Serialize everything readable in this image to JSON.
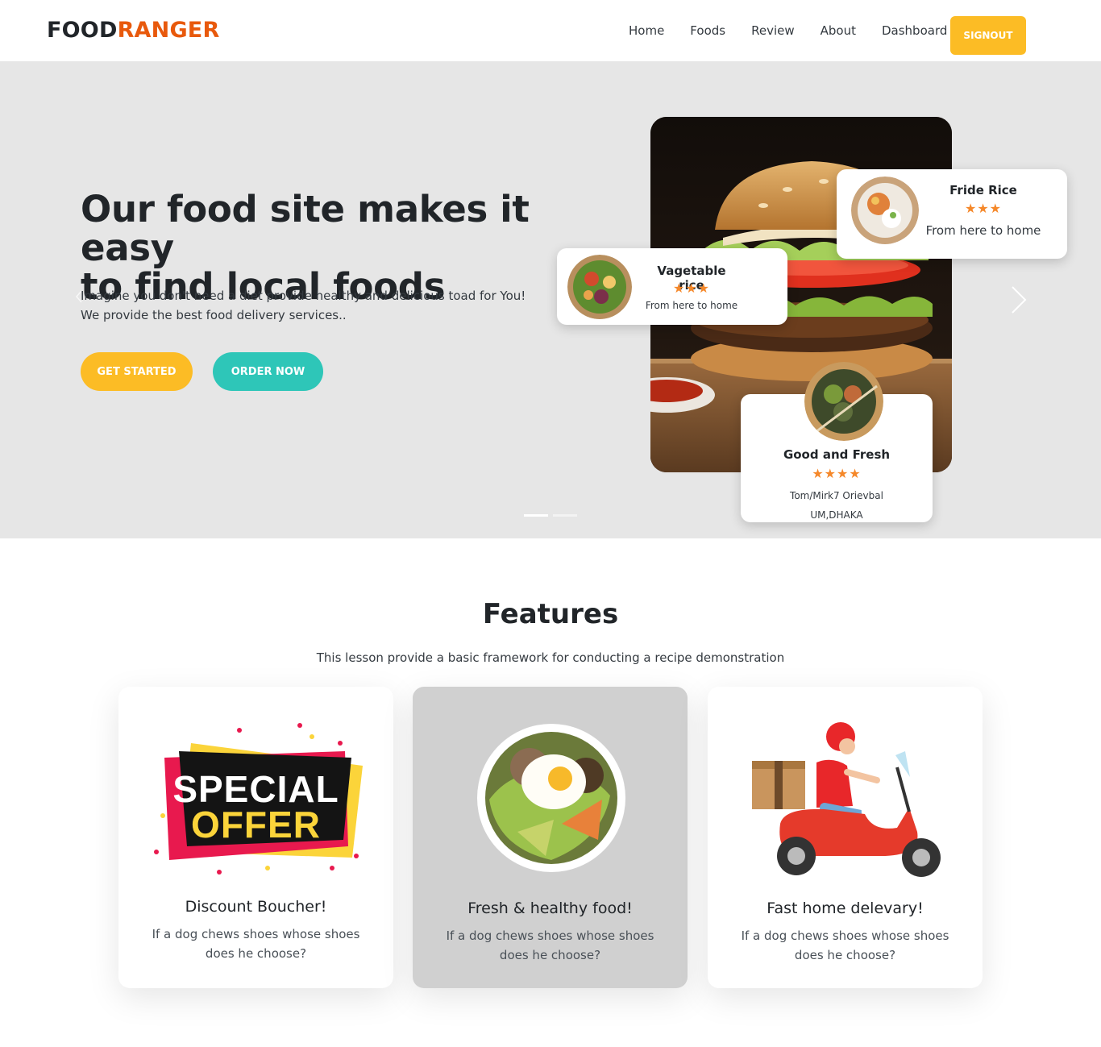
{
  "navbar": {
    "brand_part1": "FOOD",
    "brand_part2": "RANGER",
    "links": [
      "Home",
      "Foods",
      "Review",
      "About",
      "Dashboard"
    ],
    "signout_label": "SIGNOUT"
  },
  "hero": {
    "title_line1": "Our food site makes it easy",
    "title_line2": "to find local foods",
    "desc_line1": "Imagine you don't need a diet provide healthy and delicious toad for You!",
    "desc_line2": "We provide the best food delivery services..",
    "get_started_label": "GET STARTED",
    "order_now_label": "ORDER NOW",
    "prev_icon": "chevron-left-icon",
    "next_icon": "chevron-right-icon",
    "slides_count": 2,
    "active_slide": 1
  },
  "float_cards": {
    "fride": {
      "title": "Fride Rice",
      "stars": "★★★",
      "rating": 3,
      "subtitle": "From here to home"
    },
    "veg": {
      "title": "Vagetable rice",
      "stars": "★★★",
      "rating": 3,
      "subtitle": "From here to home"
    },
    "good": {
      "title": "Good and Fresh",
      "stars": "★★★★",
      "rating": 4,
      "line1": "Tom/Mirk7 Orievbal",
      "line2": "UM,DHAKA"
    }
  },
  "features": {
    "title": "Features",
    "subtitle": "This lesson provide a basic framework for conducting a recipe demonstration",
    "cards": [
      {
        "title": "Discount Boucher!",
        "text_line1": "If a dog chews shoes whose shoes",
        "text_line2": "does he choose?",
        "badge_line1": "SPECIAL",
        "badge_line2": "OFFER"
      },
      {
        "title": "Fresh & healthy food!",
        "text_line1": "If a dog chews shoes whose shoes",
        "text_line2": "does he choose?"
      },
      {
        "title": "Fast home delevary!",
        "text_line1": "If a dog chews shoes whose shoes",
        "text_line2": "does he choose?"
      }
    ]
  },
  "colors": {
    "accent_orange": "#e8590c",
    "button_yellow": "#fcbc25",
    "button_teal": "#2ec6b8",
    "star_orange": "#f5882a",
    "hero_bg": "#e6e6e6"
  }
}
